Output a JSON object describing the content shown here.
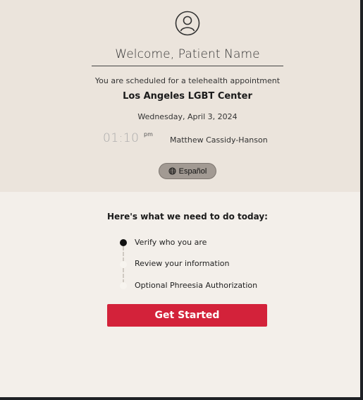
{
  "header": {
    "welcome": "Welcome, Patient Name",
    "scheduled_text": "You are scheduled for a telehealth appointment",
    "clinic_name": "Los Angeles LGBT Center",
    "date": "Wednesday, April 3, 2024",
    "time": "01:10",
    "ampm": "pm",
    "provider": "Matthew Cassidy-Hanson",
    "language_button": "Español"
  },
  "steps": {
    "title": "Here's what we need to do today:",
    "items": [
      {
        "label": "Verify who you are",
        "status": "current"
      },
      {
        "label": "Review your information",
        "status": "pending"
      },
      {
        "label": "Optional Phreesia Authorization",
        "status": "pending"
      }
    ]
  },
  "cta": {
    "label": "Get Started",
    "color": "#d3223a"
  },
  "icons": {
    "avatar": "user-circle-icon",
    "language": "globe-icon"
  },
  "colors": {
    "header_bg": "#ebe4dc",
    "body_bg": "#f3efea",
    "pill_bg": "#a29a93"
  }
}
